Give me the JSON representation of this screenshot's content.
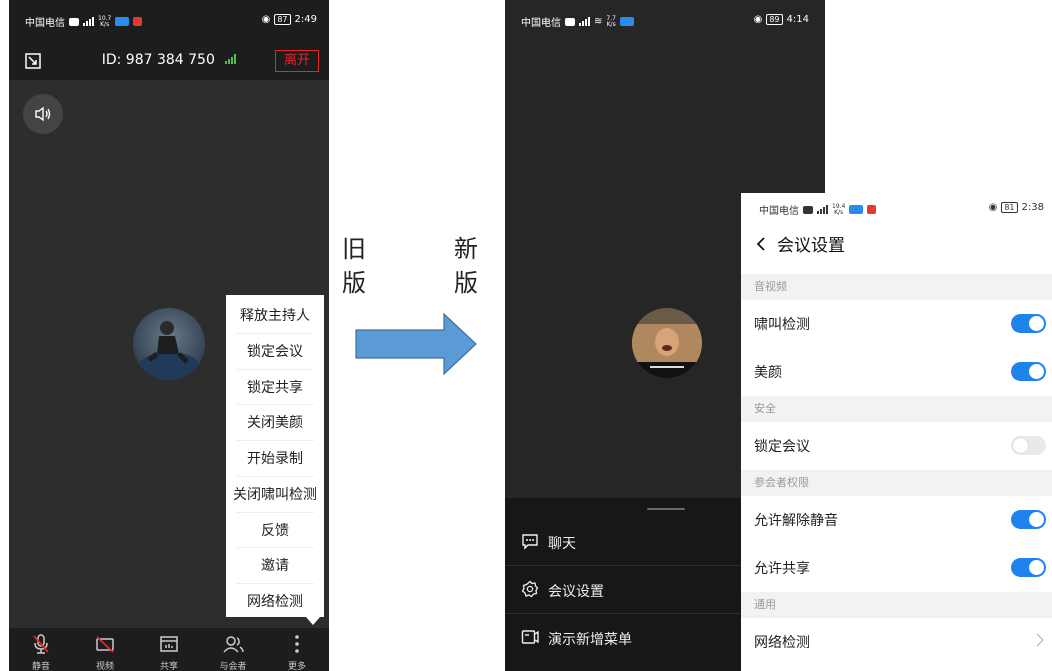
{
  "old_screen": {
    "status_bar": {
      "carrier": "中国电信",
      "net_speed_value": "10.7",
      "net_speed_unit": "K/s",
      "battery": "87",
      "time": "2:49"
    },
    "header": {
      "meeting_id_label": "ID:",
      "meeting_id": "987 384 750",
      "leave_button": "离开"
    },
    "more_menu": [
      "释放主持人",
      "锁定会议",
      "锁定共享",
      "关闭美颜",
      "开始录制",
      "关闭啸叫检测",
      "反馈",
      "邀请",
      "网络检测"
    ],
    "toolbar": [
      {
        "label": "静音",
        "icon": "mic-muted-icon"
      },
      {
        "label": "视频",
        "icon": "video-off-icon"
      },
      {
        "label": "共享",
        "icon": "share-icon"
      },
      {
        "label": "与会者",
        "icon": "participants-icon"
      },
      {
        "label": "更多",
        "icon": "more-icon"
      }
    ]
  },
  "comparison": {
    "old_label": "旧版",
    "new_label": "新版",
    "arrow_color": "#5b9bd5"
  },
  "new_screen": {
    "status_bar": {
      "carrier": "中国电信",
      "net_speed_value": "7.7",
      "net_speed_unit": "K/s",
      "battery": "89",
      "time": "4:14"
    },
    "bottom_sheet": [
      {
        "label": "聊天",
        "icon": "chat-icon"
      },
      {
        "label": "会议设置",
        "icon": "gear-icon"
      },
      {
        "label": "演示新增菜单",
        "icon": "screen-share-icon"
      }
    ]
  },
  "settings_screen": {
    "status_bar": {
      "carrier": "中国电信",
      "net_speed_value": "19.4",
      "net_speed_unit": "K/s",
      "battery": "81",
      "time": "2:38"
    },
    "title": "会议设置",
    "sections": [
      {
        "header": "音视频",
        "items": [
          {
            "label": "啸叫检测",
            "on": true
          },
          {
            "label": "美颜",
            "on": true
          }
        ]
      },
      {
        "header": "安全",
        "items": [
          {
            "label": "锁定会议",
            "on": false
          }
        ]
      },
      {
        "header": "参会者权限",
        "items": [
          {
            "label": "允许解除静音",
            "on": true
          },
          {
            "label": "允许共享",
            "on": true
          }
        ]
      },
      {
        "header": "通用",
        "items": [
          {
            "label": "网络检测"
          }
        ]
      }
    ],
    "toggle_on_color": "#1f83ee"
  }
}
